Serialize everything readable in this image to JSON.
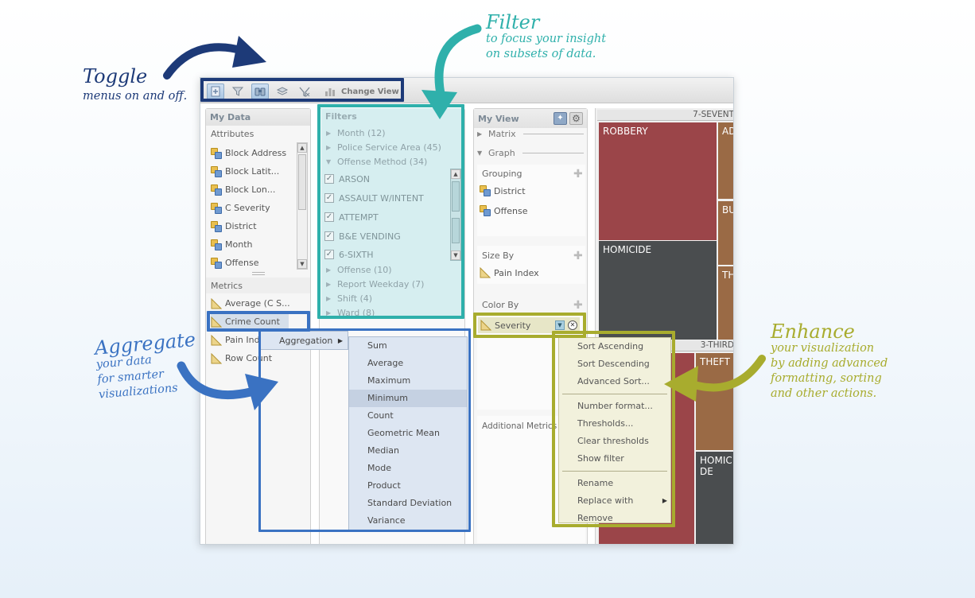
{
  "callouts": {
    "toggle": {
      "title": "Toggle",
      "subtitle": "menus on and off."
    },
    "filter": {
      "title": "Filter",
      "subtitle_line1": "to focus your insight",
      "subtitle_line2": "on subsets of data."
    },
    "aggregate": {
      "title": "Aggregate",
      "subtitle_line1": "your data",
      "subtitle_line2": "for smarter",
      "subtitle_line3": "visualizations"
    },
    "enhance": {
      "title": "Enhance",
      "subtitle_line1": "your visualization",
      "subtitle_line2": "by adding advanced",
      "subtitle_line3": "formatting, sorting",
      "subtitle_line4": "and other actions."
    }
  },
  "colors": {
    "toggle": "#1d3a78",
    "filter": "#2fb0ab",
    "aggregate": "#3a72c2",
    "enhance": "#a8ac2e",
    "robbery": "#9b4549",
    "homicide": "#4a4d4f",
    "brown": "#9a6a45"
  },
  "toolbar": {
    "icons": [
      "add-data-icon",
      "filter-icon",
      "binoculars-icon",
      "aggregate-icon",
      "enhance-icon"
    ],
    "change_view": "Change View"
  },
  "my_data": {
    "title": "My Data",
    "attributes_label": "Attributes",
    "attributes": [
      "Block Address",
      "Block Latit...",
      "Block Lon...",
      "C Severity",
      "District",
      "Month",
      "Offense"
    ],
    "metrics_label": "Metrics",
    "metrics": [
      "Average (C S...",
      "Crime Count",
      "Pain Ind",
      "Row Count"
    ]
  },
  "aggregation_menu": {
    "label": "Aggregation",
    "items": [
      "Sum",
      "Average",
      "Maximum",
      "Minimum",
      "Count",
      "Geometric Mean",
      "Median",
      "Mode",
      "Product",
      "Standard Deviation",
      "Variance"
    ],
    "highlighted": "Minimum"
  },
  "filters": {
    "title": "Filters",
    "groups_top": [
      "Month (12)",
      "Police Service Area (45)"
    ],
    "open_group": "Offense Method (34)",
    "checked": [
      "ARSON",
      "ASSAULT W/INTENT",
      "ATTEMPT",
      "B&E VENDING",
      "6-SIXTH"
    ],
    "groups_bottom": [
      "Offense (10)",
      "Report Weekday (7)",
      "Shift (4)",
      "Ward (8)"
    ]
  },
  "my_view": {
    "title": "My View",
    "matrix": "Matrix",
    "graph": "Graph",
    "grouping_label": "Grouping",
    "grouping": [
      "District",
      "Offense"
    ],
    "size_by_label": "Size By",
    "size_by": "Pain Index",
    "color_by_label": "Color By",
    "color_by": "Severity",
    "additional_metrics": "Additional Metrics"
  },
  "enhance_menu": {
    "group1": [
      "Sort Ascending",
      "Sort Descending",
      "Advanced Sort..."
    ],
    "group2": [
      "Number format...",
      "Thresholds...",
      "Clear thresholds",
      "Show filter"
    ],
    "group3": [
      "Rename",
      "Replace with",
      "Remove"
    ]
  },
  "treemap": {
    "header_top": "7-SEVENT",
    "header_mid": "3-THIRD",
    "cells": {
      "robbery": "ROBBERY",
      "homicide": "HOMICIDE",
      "ad": "AD",
      "bu": "BU",
      "th": "TH",
      "theft": "THEFT",
      "homicide2_line1": "HOMICI",
      "homicide2_line2": "DE"
    }
  }
}
